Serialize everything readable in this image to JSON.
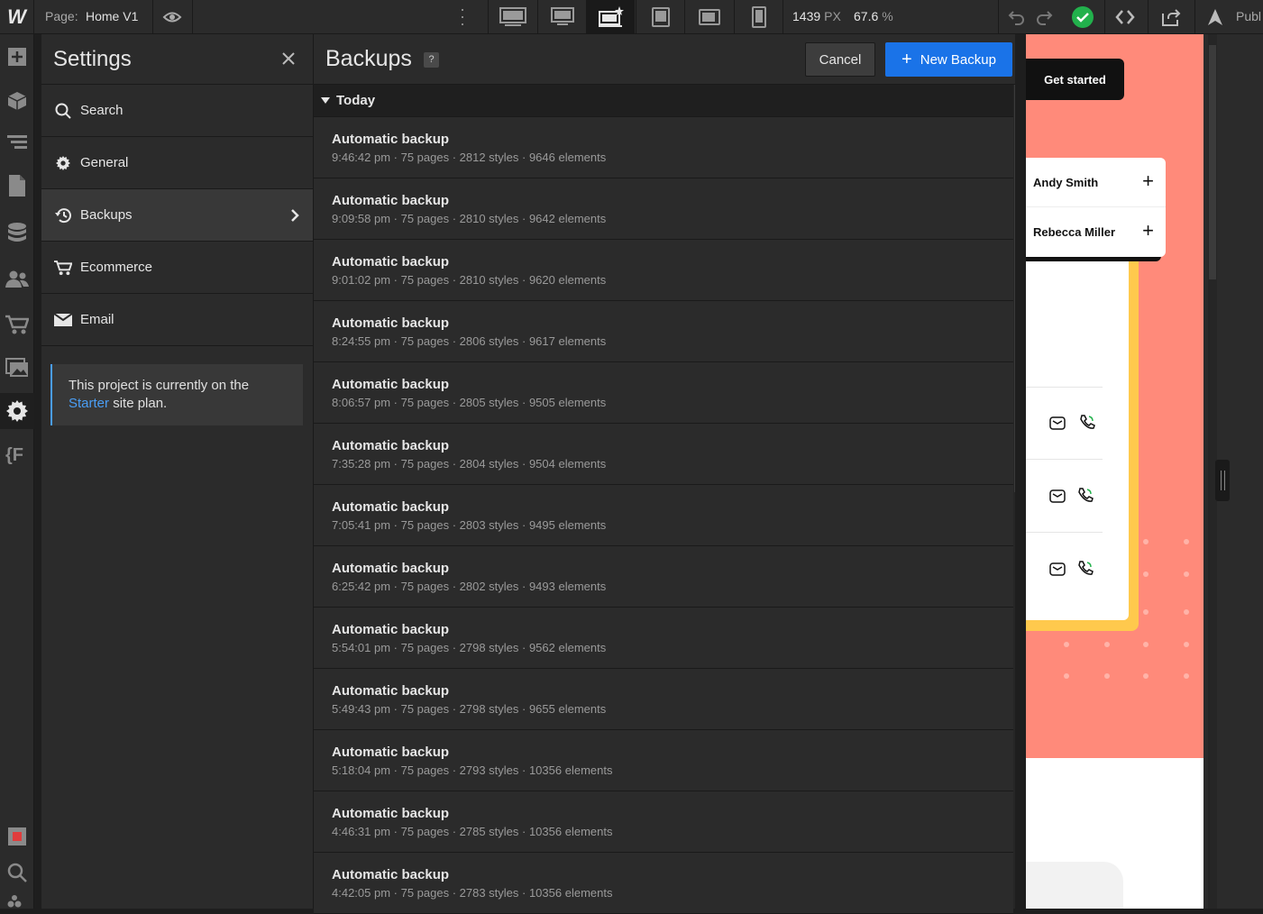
{
  "topbar": {
    "page_label": "Page:",
    "page_name": "Home V1",
    "width_value": "1439",
    "width_unit": "PX",
    "zoom_value": "67.6",
    "zoom_unit": "%",
    "publish_label": "Publ",
    "status_color": "#22b14c",
    "devices": [
      "desktop-xl-icon",
      "desktop-l-icon",
      "desktop-base-icon",
      "tablet-icon",
      "mobile-landscape-icon",
      "mobile-portrait-icon"
    ]
  },
  "settings": {
    "title": "Settings",
    "items": [
      {
        "label": "Search",
        "icon": "search-icon"
      },
      {
        "label": "General",
        "icon": "gear-icon"
      },
      {
        "label": "Backups",
        "icon": "history-icon"
      },
      {
        "label": "Ecommerce",
        "icon": "cart-icon"
      },
      {
        "label": "Email",
        "icon": "mail-icon"
      }
    ],
    "plan_text_1": "This project is currently on the",
    "plan_link": "Starter",
    "plan_text_2": "site plan."
  },
  "backups": {
    "title": "Backups",
    "help": "?",
    "cancel_label": "Cancel",
    "new_label": "New Backup",
    "group_label": "Today",
    "rows": [
      {
        "title": "Automatic backup",
        "detail": "9:46:42 pm · 75 pages · 2812 styles · 9646 elements"
      },
      {
        "title": "Automatic backup",
        "detail": "9:09:58 pm · 75 pages · 2810 styles · 9642 elements"
      },
      {
        "title": "Automatic backup",
        "detail": "9:01:02 pm · 75 pages · 2810 styles · 9620 elements"
      },
      {
        "title": "Automatic backup",
        "detail": "8:24:55 pm · 75 pages · 2806 styles · 9617 elements"
      },
      {
        "title": "Automatic backup",
        "detail": "8:06:57 pm · 75 pages · 2805 styles · 9505 elements"
      },
      {
        "title": "Automatic backup",
        "detail": "7:35:28 pm · 75 pages · 2804 styles · 9504 elements"
      },
      {
        "title": "Automatic backup",
        "detail": "7:05:41 pm · 75 pages · 2803 styles · 9495 elements"
      },
      {
        "title": "Automatic backup",
        "detail": "6:25:42 pm · 75 pages · 2802 styles · 9493 elements"
      },
      {
        "title": "Automatic backup",
        "detail": "5:54:01 pm · 75 pages · 2798 styles · 9562 elements"
      },
      {
        "title": "Automatic backup",
        "detail": "5:49:43 pm · 75 pages · 2798 styles · 9655 elements"
      },
      {
        "title": "Automatic backup",
        "detail": "5:18:04 pm · 75 pages · 2793 styles · 10356 elements"
      },
      {
        "title": "Automatic backup",
        "detail": "4:46:31 pm · 75 pages · 2785 styles · 10356 elements"
      },
      {
        "title": "Automatic backup",
        "detail": "4:42:05 pm · 75 pages · 2783 styles · 10356 elements"
      }
    ]
  },
  "canvas": {
    "cta_label": "Get started",
    "contacts": [
      "Andy Smith",
      "Rebecca Miller"
    ],
    "bg_color": "#ff8a7a",
    "accent_color": "#ffc94d"
  }
}
